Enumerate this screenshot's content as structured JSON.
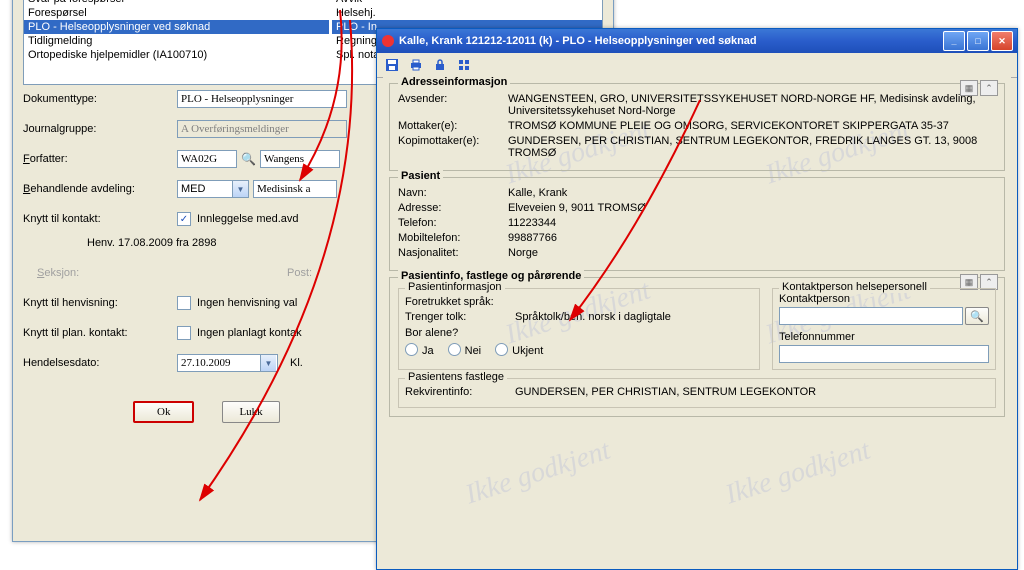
{
  "bg": {
    "list_col1": [
      "Svar på forespørsel",
      "Forespørsel",
      "PLO - Helseopplysninger ved søknad",
      "Tidligmelding",
      "Ortopediske hjelpemidler (IA100710)"
    ],
    "list_col2": [
      "Avvik",
      "Helsehj.",
      "PLO - In",
      "Regning",
      "Spl. nota"
    ],
    "list_selected": 2,
    "labels": {
      "dokumenttype": "Dokumenttype:",
      "journalgruppe": "Journalgruppe:",
      "forfatter": "Forfatter:",
      "beh_avdeling": "Behandlende avdeling:",
      "knytt_kontakt": "Knytt til kontakt:",
      "seksjon": "Seksjon:",
      "post": "Post:",
      "knytt_henv": "Knytt til henvisning:",
      "knytt_plan": "Knytt til plan. kontakt:",
      "hendelsesdato": "Hendelsesdato:",
      "kl": "Kl."
    },
    "values": {
      "dokumenttype": "PLO - Helseopplysninger",
      "journalgruppe": "A Overføringsmeldinger",
      "forfatter_code": "WA02G",
      "forfatter_name": "Wangens",
      "avdeling_code": "MED",
      "avdeling_name": "Medisinsk a",
      "kontakt_chk_label": "Innleggelse med.avd",
      "kontakt_chk": true,
      "henv_line": "Henv. 17.08.2009 fra 2898",
      "ingen_henvisning": "Ingen henvisning val",
      "ingen_planlagt": "Ingen planlagt kontak",
      "hendelsesdato": "27.10.2009"
    },
    "buttons": {
      "ok": "Ok",
      "lukk": "Lukk"
    },
    "underlines": {
      "forfatter": "F",
      "beh": "B",
      "seksjon": "S",
      "post": "P",
      "ok": "O"
    }
  },
  "fg": {
    "title": "Kalle, Krank  121212-12011 (k) - PLO - Helseopplysninger ved søknad",
    "toolbar_icons": [
      "save-icon",
      "print-icon",
      "lock-icon",
      "grid-icon"
    ],
    "adresse": {
      "legend": "Adresseinformasjon",
      "avsender_k": "Avsender:",
      "avsender_v": "WANGENSTEEN, GRO, UNIVERSITETSSYKEHUSET NORD-NORGE HF, Medisinsk avdeling, Universitetssykehuset Nord-Norge",
      "mottaker_k": "Mottaker(e):",
      "mottaker_v": "TROMSØ KOMMUNE PLEIE OG OMSORG, SERVICEKONTORET SKIPPERGATA 35-37",
      "kopi_k": "Kopimottaker(e):",
      "kopi_v": "GUNDERSEN, PER CHRISTIAN, SENTRUM LEGEKONTOR, FREDRIK LANGES GT. 13, 9008 TROMSØ"
    },
    "pasient": {
      "legend": "Pasient",
      "navn_k": "Navn:",
      "navn_v": "Kalle, Krank",
      "adresse_k": "Adresse:",
      "adresse_v": "Elveveien 9, 9011 TROMSØ",
      "telefon_k": "Telefon:",
      "telefon_v": "11223344",
      "mobil_k": "Mobiltelefon:",
      "mobil_v": "99887766",
      "nasjonalitet_k": "Nasjonalitet:",
      "nasjonalitet_v": "Norge"
    },
    "pinfo": {
      "legend": "Pasientinfo, fastlege og pårørende",
      "sub_pasientinfo": "Pasientinformasjon",
      "sprak_k": "Foretrukket språk:",
      "tolk_k": "Trenger tolk:",
      "tolk_v": "Språktolk/beh. norsk i dagligtale",
      "bor_alene": "Bor alene?",
      "ja": "Ja",
      "nei": "Nei",
      "ukjent": "Ukjent",
      "sub_kontakt": "Kontaktperson helsepersonell",
      "kontaktperson": "Kontaktperson",
      "telefonnummer": "Telefonnummer",
      "sub_fastlege": "Pasientens fastlege",
      "rekv_k": "Rekvirentinfo:",
      "rekv_v": "GUNDERSEN, PER CHRISTIAN, SENTRUM LEGEKONTOR"
    },
    "watermark": "Ikke godkjent"
  }
}
